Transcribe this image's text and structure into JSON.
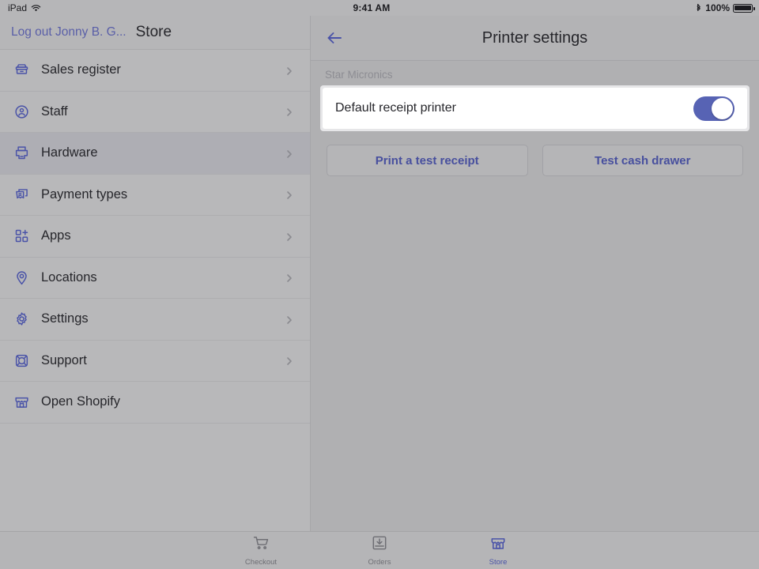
{
  "statusbar": {
    "device": "iPad",
    "wifi_icon": "wifi-icon",
    "time": "9:41 AM",
    "bluetooth_icon": "bluetooth-icon",
    "battery_percent": "100%",
    "battery_icon": "battery-full-icon"
  },
  "sidebar": {
    "logout_label": "Log out Jonny B. G...",
    "title": "Store",
    "items": [
      {
        "label": "Sales register",
        "icon": "cash-register-icon",
        "chevron": true,
        "selected": false
      },
      {
        "label": "Staff",
        "icon": "person-circle-icon",
        "chevron": true,
        "selected": false
      },
      {
        "label": "Hardware",
        "icon": "printer-icon",
        "chevron": true,
        "selected": true
      },
      {
        "label": "Payment types",
        "icon": "payment-cards-icon",
        "chevron": true,
        "selected": false
      },
      {
        "label": "Apps",
        "icon": "apps-grid-plus-icon",
        "chevron": true,
        "selected": false
      },
      {
        "label": "Locations",
        "icon": "map-pin-icon",
        "chevron": true,
        "selected": false
      },
      {
        "label": "Settings",
        "icon": "gear-icon",
        "chevron": true,
        "selected": false
      },
      {
        "label": "Support",
        "icon": "lifebuoy-icon",
        "chevron": true,
        "selected": false
      },
      {
        "label": "Open Shopify",
        "icon": "storefront-icon",
        "chevron": false,
        "selected": false
      }
    ]
  },
  "detail": {
    "back_icon": "back-arrow-icon",
    "title": "Printer settings",
    "section_label": "Star Micronics",
    "setting": {
      "label": "Default receipt printer",
      "toggle_on": true,
      "toggle_name": "default-receipt-printer-toggle"
    },
    "buttons": [
      {
        "label": "Print a test receipt",
        "name": "print-test-receipt-button"
      },
      {
        "label": "Test cash drawer",
        "name": "test-cash-drawer-button"
      }
    ]
  },
  "tabbar": {
    "tabs": [
      {
        "label": "Checkout",
        "icon": "shopping-cart-icon",
        "active": false
      },
      {
        "label": "Orders",
        "icon": "inbox-download-icon",
        "active": false
      },
      {
        "label": "Store",
        "icon": "storefront-icon",
        "active": true
      }
    ]
  },
  "colors": {
    "accent_indigo": "#5763b4",
    "button_text": "#474f9e",
    "section_label": "#8d8d93",
    "sidebar_bg": "#b8b8ba",
    "detail_bg": "#b0b0b2"
  }
}
